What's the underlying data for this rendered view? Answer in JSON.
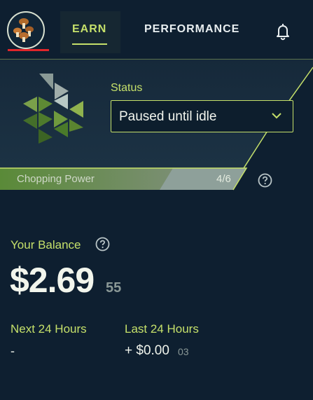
{
  "header": {
    "tabs": [
      {
        "label": "EARN",
        "active": true
      },
      {
        "label": "PERFORMANCE",
        "active": false
      }
    ],
    "avatar_icon": "mushroom-icon",
    "notification_icon": "bell-icon"
  },
  "status": {
    "label": "Status",
    "selected": "Paused until idle",
    "dropdown_icon": "chevron-down-icon"
  },
  "chopping_power": {
    "label": "Chopping Power",
    "count": "4/6",
    "level_fraction": 0.667,
    "help_icon": "help-circle-icon"
  },
  "balance": {
    "label": "Your Balance",
    "main": "$2.69",
    "sub": "55",
    "help_icon": "help-circle-icon"
  },
  "stats": {
    "next": {
      "label": "Next 24 Hours",
      "value": "-"
    },
    "last": {
      "label": "Last 24 Hours",
      "value": "+ $0.00",
      "sub": "03"
    }
  },
  "colors": {
    "accent": "#c5e06a",
    "background": "#0e1f30",
    "alert_underline": "#e0262b",
    "power_fill": "#5c8a3a"
  }
}
